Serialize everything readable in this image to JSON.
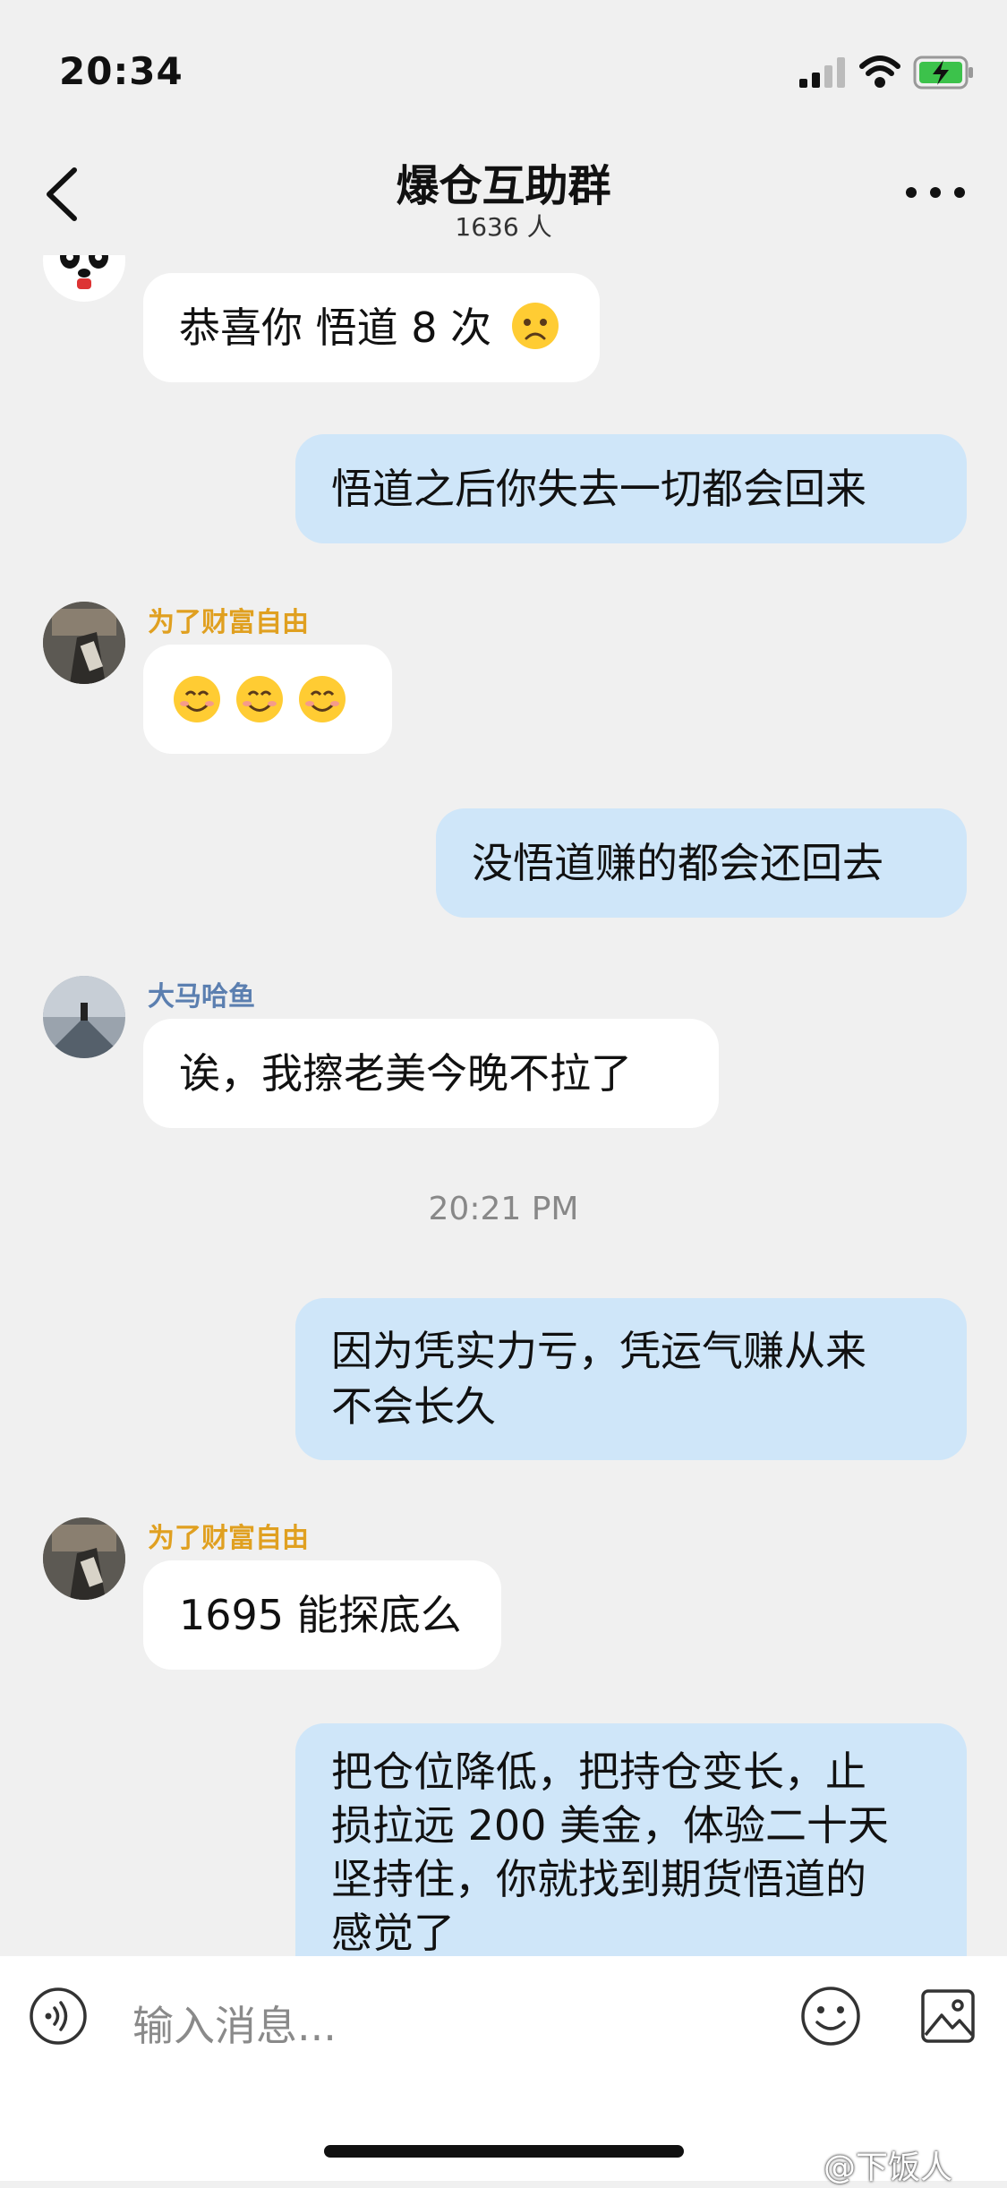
{
  "status": {
    "time": "20:34"
  },
  "nav": {
    "title": "爆仓互助群",
    "member_count": "1636 人"
  },
  "messages": [
    {
      "text": "恭喜你 悟道 8 次"
    },
    {
      "text": "悟道之后你失去一切都会回来"
    },
    {
      "sender": "为了财富自由"
    },
    {
      "text": "没悟道赚的都会还回去"
    },
    {
      "sender": "大马哈鱼",
      "text": "诶，我擦老美今晚不拉了"
    },
    {
      "timestamp": "20:21 PM"
    },
    {
      "line1": "因为凭实力亏，凭运气赚从来",
      "line2": "不会长久"
    },
    {
      "sender": "为了财富自由",
      "text": "1695 能探底么"
    },
    {
      "line1": "把仓位降低，把持仓变长，止",
      "line2": "损拉远 200 美金，体验二十天",
      "line3": "坚持住，你就找到期货悟道的",
      "line4": "感觉了"
    }
  ],
  "input": {
    "placeholder": "输入消息..."
  },
  "watermark": "@下饭人",
  "colors": {
    "sender_gold": "#e0a020",
    "sender_blue": "#5b7fb0",
    "out_bubble": "#cfe6f9"
  }
}
